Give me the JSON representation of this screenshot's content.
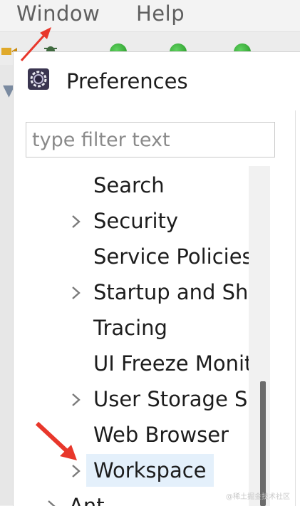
{
  "menubar": {
    "items": [
      "Window",
      "Help"
    ]
  },
  "dialog": {
    "title": "Preferences",
    "filter": {
      "placeholder": "type filter text",
      "value": ""
    },
    "tree": [
      {
        "label": "Search",
        "expandable": false,
        "selected": false
      },
      {
        "label": "Security",
        "expandable": true,
        "selected": false
      },
      {
        "label": "Service Policies",
        "expandable": false,
        "selected": false
      },
      {
        "label": "Startup and Shutdown",
        "expandable": true,
        "selected": false
      },
      {
        "label": "Tracing",
        "expandable": false,
        "selected": false
      },
      {
        "label": "UI Freeze Monitoring",
        "expandable": false,
        "selected": false
      },
      {
        "label": "User Storage Service",
        "expandable": true,
        "selected": false
      },
      {
        "label": "Web Browser",
        "expandable": false,
        "selected": false
      },
      {
        "label": "Workspace",
        "expandable": true,
        "selected": true
      },
      {
        "label": "Ant",
        "expandable": true,
        "selected": false
      }
    ]
  },
  "annotations": {
    "arrow_color": "#e8372b"
  },
  "watermark": "@稀土掘金技术社区"
}
